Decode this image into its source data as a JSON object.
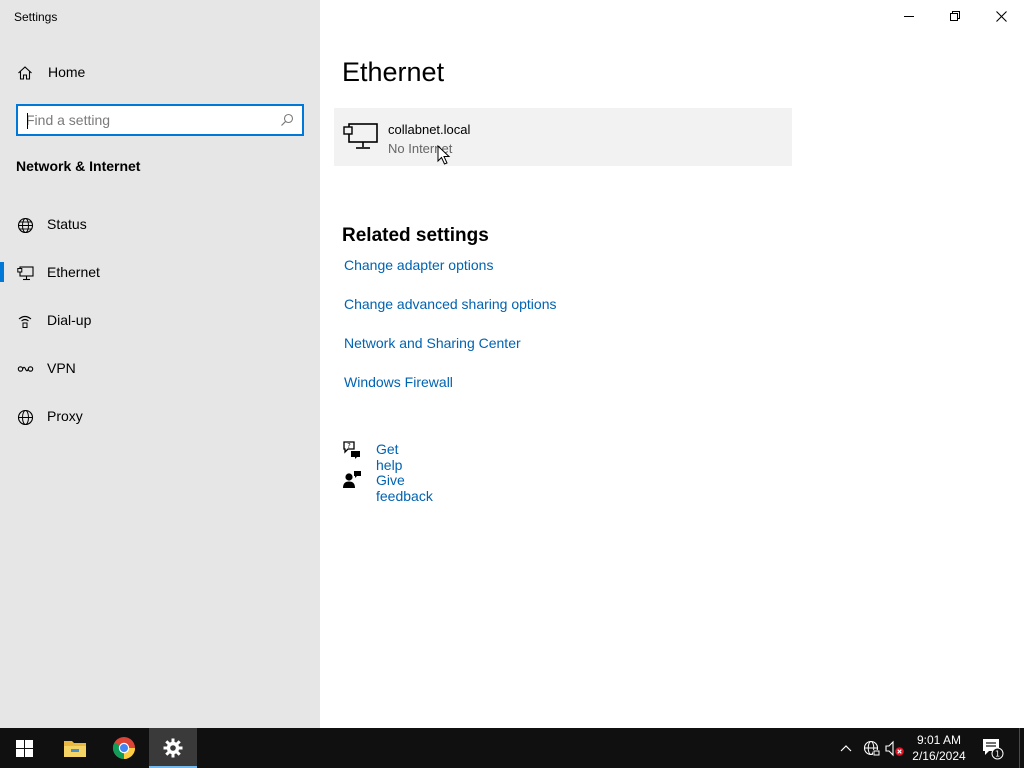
{
  "window": {
    "title": "Settings",
    "controls": [
      "minimize-icon",
      "restore-icon",
      "close-icon"
    ]
  },
  "sidebar": {
    "home_label": "Home",
    "home_icon": "home-icon",
    "search": {
      "placeholder": "Find a setting",
      "value": ""
    },
    "section_heading": "Network & Internet",
    "items": [
      {
        "label": "Status",
        "icon": "globe-status-icon",
        "selected": false
      },
      {
        "label": "Ethernet",
        "icon": "ethernet-icon",
        "selected": true
      },
      {
        "label": "Dial-up",
        "icon": "dialup-icon",
        "selected": false
      },
      {
        "label": "VPN",
        "icon": "vpn-icon",
        "selected": false
      },
      {
        "label": "Proxy",
        "icon": "globe-icon",
        "selected": false
      }
    ]
  },
  "main": {
    "title": "Ethernet",
    "network": {
      "name": "collabnet.local",
      "status": "No Internet",
      "icon": "monitor-network-icon"
    },
    "related": {
      "heading": "Related settings",
      "links": [
        "Change adapter options",
        "Change advanced sharing options",
        "Network and Sharing Center",
        "Windows Firewall"
      ]
    },
    "help": [
      {
        "label": "Get help",
        "icon": "chat-help-icon"
      },
      {
        "label": "Give feedback",
        "icon": "feedback-person-icon"
      }
    ]
  },
  "taskbar": {
    "apps": [
      "windows-start-icon",
      "file-explorer-icon",
      "chrome-icon",
      "settings-gear-icon"
    ],
    "active_app": "settings-gear-icon",
    "tray": [
      "chevron-up-icon",
      "network-globe-icon",
      "volume-muted-icon"
    ],
    "time": "9:01 AM",
    "date": "2/16/2024",
    "notification_count": "1"
  },
  "colors": {
    "accent": "#0078d7",
    "link": "#0063b1",
    "sidebar_bg": "#e6e6e6",
    "card_bg": "#f2f2f2",
    "taskbar_bg": "#101010"
  }
}
